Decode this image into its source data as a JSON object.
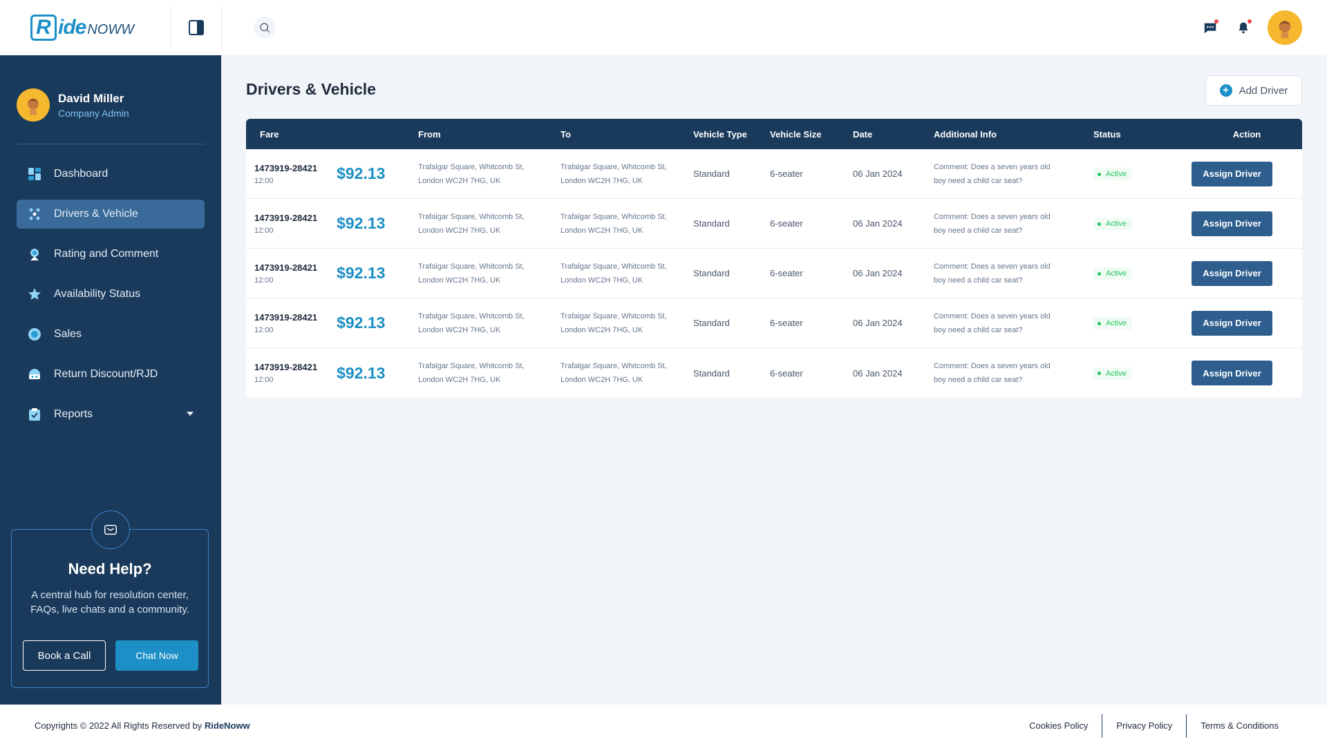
{
  "brand": {
    "logo_r": "R",
    "logo_ide": "ide",
    "logo_noww": "NOWW"
  },
  "colors": {
    "primary": "#1a3a5c",
    "accent": "#1b8fc6",
    "active_nav": "#3a6a99",
    "status_green": "#22c55e"
  },
  "profile": {
    "name": "David Miller",
    "role": "Company Admin"
  },
  "nav": [
    {
      "label": "Dashboard",
      "icon": "dashboard-icon",
      "active": false
    },
    {
      "label": "Drivers & Vehicle",
      "icon": "drivers-icon",
      "active": true
    },
    {
      "label": "Rating and Comment",
      "icon": "rating-icon",
      "active": false
    },
    {
      "label": "Availability Status",
      "icon": "star-icon",
      "active": false
    },
    {
      "label": "Sales",
      "icon": "sales-icon",
      "active": false
    },
    {
      "label": "Return Discount/RJD",
      "icon": "discount-icon",
      "active": false
    },
    {
      "label": "Reports",
      "icon": "reports-icon",
      "active": false
    }
  ],
  "help": {
    "title": "Need Help?",
    "text": "A central hub for resolution center, FAQs, live chats and a community.",
    "book_label": "Book a Call",
    "chat_label": "Chat Now"
  },
  "page": {
    "title": "Drivers & Vehicle",
    "add_label": "Add Driver"
  },
  "table": {
    "columns": [
      "Fare",
      "From",
      "To",
      "Vehicle Type",
      "Vehicle Size",
      "Date",
      "Additional Info",
      "Status",
      "Action"
    ],
    "rows": [
      {
        "id": "1473919-28421",
        "time": "12:00",
        "price": "$92.13",
        "from1": "Trafalgar Square, Whitcomb St,",
        "from2": "London WC2H 7HG, UK",
        "to1": "Trafalgar Square, Whitcomb St,",
        "to2": "London WC2H 7HG, UK",
        "vtype": "Standard",
        "vsize": "6-seater",
        "date": "06 Jan 2024",
        "info1": "Comment: Does a seven years old",
        "info2": "boy need a child car seat?",
        "status": "Active",
        "action": "Assign Driver"
      },
      {
        "id": "1473919-28421",
        "time": "12:00",
        "price": "$92.13",
        "from1": "Trafalgar Square, Whitcomb St,",
        "from2": "London WC2H 7HG, UK",
        "to1": "Trafalgar Square, Whitcomb St,",
        "to2": "London WC2H 7HG, UK",
        "vtype": "Standard",
        "vsize": "6-seater",
        "date": "06 Jan 2024",
        "info1": "Comment: Does a seven years old",
        "info2": "boy need a child car seat?",
        "status": "Active",
        "action": "Assign Driver"
      },
      {
        "id": "1473919-28421",
        "time": "12:00",
        "price": "$92.13",
        "from1": "Trafalgar Square, Whitcomb St,",
        "from2": "London WC2H 7HG, UK",
        "to1": "Trafalgar Square, Whitcomb St,",
        "to2": "London WC2H 7HG, UK",
        "vtype": "Standard",
        "vsize": "6-seater",
        "date": "06 Jan 2024",
        "info1": "Comment: Does a seven years old",
        "info2": "boy need a child car seat?",
        "status": "Active",
        "action": "Assign Driver"
      },
      {
        "id": "1473919-28421",
        "time": "12:00",
        "price": "$92.13",
        "from1": "Trafalgar Square, Whitcomb St,",
        "from2": "London WC2H 7HG, UK",
        "to1": "Trafalgar Square, Whitcomb St,",
        "to2": "London WC2H 7HG, UK",
        "vtype": "Standard",
        "vsize": "6-seater",
        "date": "06 Jan 2024",
        "info1": "Comment: Does a seven years old",
        "info2": "boy need a child car seat?",
        "status": "Active",
        "action": "Assign Driver"
      },
      {
        "id": "1473919-28421",
        "time": "12:00",
        "price": "$92.13",
        "from1": "Trafalgar Square, Whitcomb St,",
        "from2": "London WC2H 7HG, UK",
        "to1": "Trafalgar Square, Whitcomb St,",
        "to2": "London WC2H 7HG, UK",
        "vtype": "Standard",
        "vsize": "6-seater",
        "date": "06 Jan 2024",
        "info1": "Comment: Does a seven years old",
        "info2": "boy need a child car seat?",
        "status": "Active",
        "action": "Assign Driver"
      }
    ]
  },
  "footer": {
    "copy_prefix": "Copyrights © 2022 All Rights Reserved by",
    "copy_brand": "RideNoww",
    "links": [
      "Cookies Policy",
      "Privacy Policy",
      "Terms & Conditions"
    ]
  }
}
